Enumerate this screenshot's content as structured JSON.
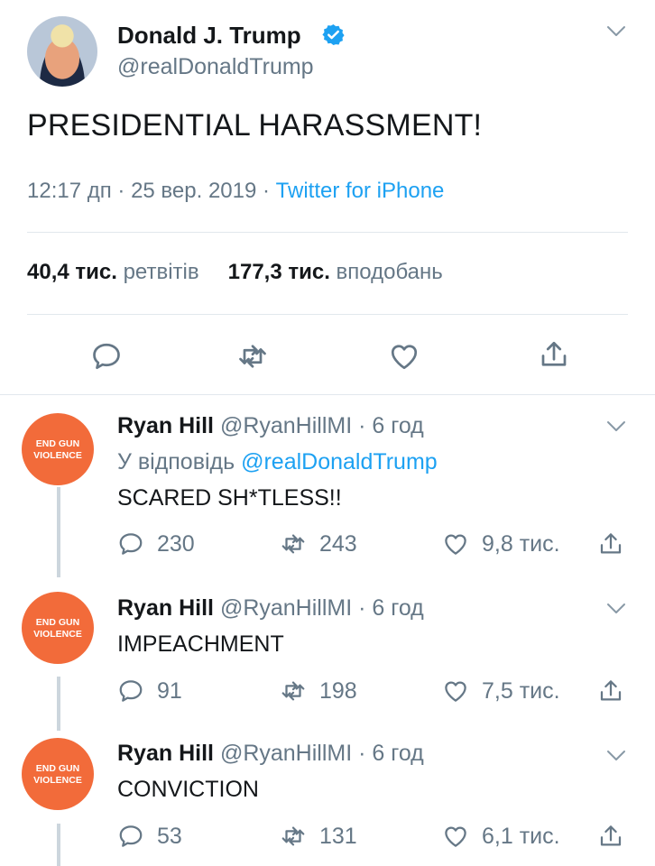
{
  "main_tweet": {
    "name": "Donald J. Trump",
    "handle": "@realDonaldTrump",
    "text": "PRESIDENTIAL HARASSMENT!",
    "time": "12:17 дп",
    "dot": " · ",
    "date": "25 вер. 2019",
    "source": "Twitter for iPhone",
    "retweets_count": "40,4 тис.",
    "retweets_label": "ретвітів",
    "likes_count": "177,3 тис.",
    "likes_label": "вподобань",
    "icons": [
      "chevron-down-icon",
      "verified-icon",
      "reply-icon",
      "retweet-icon",
      "like-icon",
      "share-icon"
    ]
  },
  "replies": [
    {
      "avatar_line1": "END GUN",
      "avatar_line2": "VIOLENCE",
      "name": "Ryan Hill",
      "handle": "@RyanHillMI",
      "time": "· 6 год",
      "reply_prefix": "У відповідь",
      "reply_to": "@realDonaldTrump",
      "text": "SCARED SH*TLESS!!",
      "replies": "230",
      "retweets": "243",
      "likes": "9,8 тис."
    },
    {
      "avatar_line1": "END GUN",
      "avatar_line2": "VIOLENCE",
      "name": "Ryan Hill",
      "handle": "@RyanHillMI",
      "time": "· 6 год",
      "text": "IMPEACHMENT",
      "replies": "91",
      "retweets": "198",
      "likes": "7,5 тис."
    },
    {
      "avatar_line1": "END GUN",
      "avatar_line2": "VIOLENCE",
      "name": "Ryan Hill",
      "handle": "@RyanHillMI",
      "time": "· 6 год",
      "text": "CONVICTION",
      "replies": "53",
      "retweets": "131",
      "likes": "6,1 тис."
    }
  ],
  "colors": {
    "accent": "#1da1f2",
    "muted": "#657786",
    "text": "#14171a",
    "divider": "#e1e8ed",
    "avatar_orange": "#f26b3a"
  }
}
